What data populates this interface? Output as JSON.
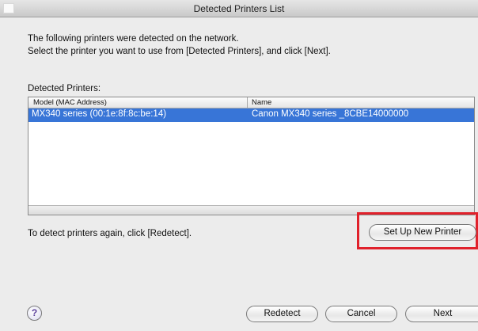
{
  "window": {
    "title": "Detected Printers List"
  },
  "intro": {
    "line1": "The following printers were detected on the network.",
    "line2": "Select the printer you want to use from [Detected Printers], and click [Next]."
  },
  "detected_printers": {
    "label": "Detected Printers:",
    "columns": [
      "Model (MAC Address)",
      "Name"
    ],
    "rows": [
      {
        "model": "MX340 series (00:1e:8f:8c:be:14)",
        "name": "Canon MX340 series _8CBE14000000",
        "selected": true
      }
    ]
  },
  "setup_button_label": "Set Up New Printer",
  "redetect_hint": "To detect printers again, click [Redetect].",
  "footer": {
    "help_label": "?",
    "redetect_label": "Redetect",
    "cancel_label": "Cancel",
    "next_label": "Next"
  },
  "colors": {
    "selection": "#3875d7",
    "highlight": "#e0212b",
    "help_glyph": "#5b3f9a"
  }
}
